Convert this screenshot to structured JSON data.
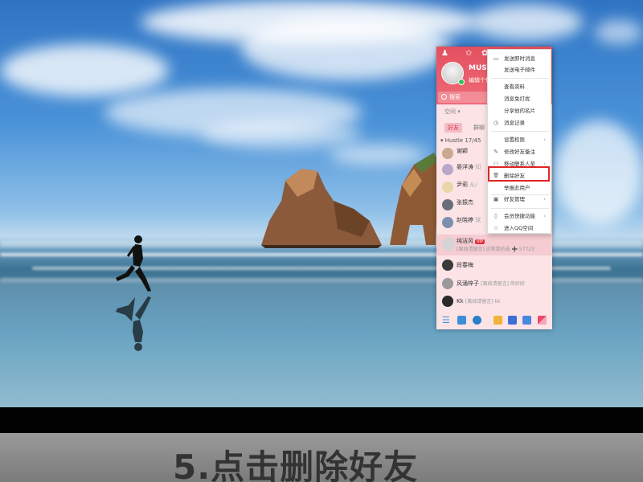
{
  "caption": "5.点击删除好友",
  "qq": {
    "nickname": "MUST",
    "signature": "编辑个性",
    "search_placeholder": "搜索",
    "space_label": "空间",
    "tabs": [
      "好友",
      "群聊"
    ],
    "group_header": "Hustle 17/45",
    "contacts": [
      {
        "name": "谢颖",
        "status": ""
      },
      {
        "name": "晏洋涛",
        "status": "知"
      },
      {
        "name": "尹莉",
        "status": "从/"
      },
      {
        "name": "张振杰",
        "status": ""
      },
      {
        "name": "赵晓婷",
        "status": "球"
      },
      {
        "name": "纯洁风",
        "status": "[离线请留言] 远程我的选 ➕ 57723",
        "vip": "VIP"
      },
      {
        "name": "段春梅",
        "status": ""
      },
      {
        "name": "风涌梓子",
        "status": "[离线请留言] 你好好"
      },
      {
        "name": "Kk",
        "status": "[离线请留言] kk"
      }
    ]
  },
  "menu": {
    "items": [
      {
        "label": "发送即时消息",
        "icon": "chat-icon",
        "glyph": "▭"
      },
      {
        "label": "发送电子邮件",
        "icon": "",
        "glyph": ""
      },
      {
        "label": "查看资料",
        "icon": "",
        "glyph": ""
      },
      {
        "label": "消息免打扰",
        "icon": "",
        "glyph": ""
      },
      {
        "label": "分享他的名片",
        "icon": "",
        "glyph": ""
      },
      {
        "label": "消息记录",
        "icon": "clock-icon",
        "glyph": "◷"
      },
      {
        "label": "设置权限",
        "icon": "",
        "glyph": "",
        "arrow": true
      },
      {
        "label": "修改好友备注",
        "icon": "pencil-icon",
        "glyph": "✎"
      },
      {
        "label": "移动联系人至",
        "icon": "person-icon",
        "glyph": "⚇",
        "arrow": true
      },
      {
        "label": "删除好友",
        "icon": "trash-icon",
        "glyph": "🗑"
      },
      {
        "label": "举报此用户",
        "icon": "",
        "glyph": ""
      },
      {
        "label": "好友管理",
        "icon": "image-icon",
        "glyph": "▣",
        "arrow": true
      },
      {
        "label": "会员快捷功能",
        "icon": "drop-icon",
        "glyph": "◊",
        "arrow": true
      },
      {
        "label": "进入QQ空间",
        "icon": "star-icon",
        "glyph": "☆"
      }
    ]
  },
  "colors": {
    "qq_header": "#e4505f",
    "panel_bg": "#fbe3e6",
    "highlight_red": "#e02424"
  }
}
